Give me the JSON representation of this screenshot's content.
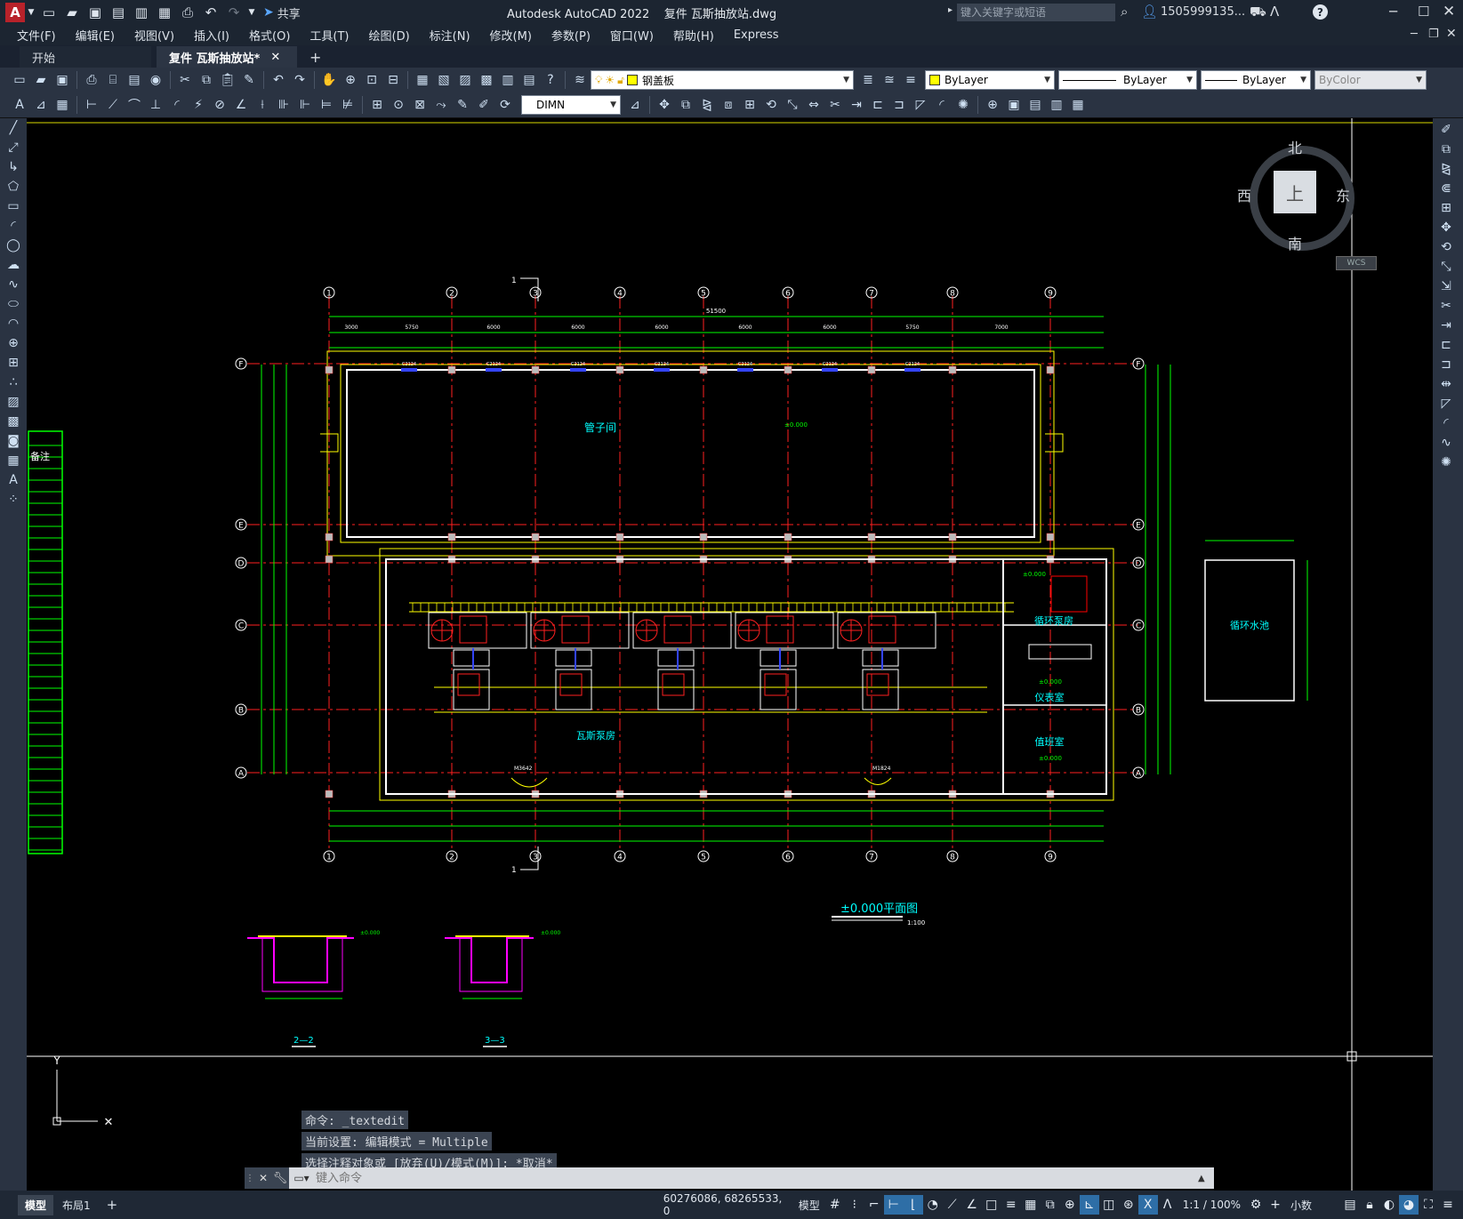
{
  "app": {
    "window_title": "Autodesk AutoCAD 2022    复件 瓦斯抽放站.dwg",
    "share_label": "共享",
    "search_placeholder": "键入关键字或短语",
    "user": "1505999135..."
  },
  "menu": [
    "文件(F)",
    "编辑(E)",
    "视图(V)",
    "插入(I)",
    "格式(O)",
    "工具(T)",
    "绘图(D)",
    "标注(N)",
    "修改(M)",
    "参数(P)",
    "窗口(W)",
    "帮助(H)",
    "Express"
  ],
  "tabs": {
    "start": "开始",
    "doc": "复件 瓦斯抽放站*"
  },
  "toolbar": {
    "layer": "钢盖板",
    "layer_color": "#ffff00",
    "color": "ByLayer",
    "linetype": "ByLayer",
    "lineweight": "ByLayer",
    "plotstyle": "ByColor",
    "dimstyle": "DIMN"
  },
  "viewcube": {
    "north": "北",
    "south": "南",
    "east": "东",
    "west": "西",
    "face": "上",
    "wcs": "WCS"
  },
  "drawing": {
    "grid_cols": [
      "1",
      "2",
      "3",
      "4",
      "5",
      "6",
      "7",
      "8",
      "9"
    ],
    "grid_rows": [
      "F",
      "E",
      "D",
      "C",
      "B",
      "A"
    ],
    "total_dim": "51500",
    "top_dims": [
      "3000",
      "5750",
      "6000",
      "6000",
      "6000",
      "6000",
      "6000",
      "5750",
      "7000"
    ],
    "rooms": {
      "pipe": "管子间",
      "pump": "瓦斯泵房",
      "circ": "循环泵房",
      "inst": "仪表室",
      "duty": "值班室",
      "pool": "循环水池"
    },
    "level": "±0.000",
    "plan_title": "±0.000平面图",
    "plan_scale": "1:100",
    "notes_label": "备注",
    "section_a": "2—2",
    "section_b": "3—3",
    "cut_mark": "1",
    "window_tag": "C2124",
    "door_tag": "M3642",
    "door_tag2": "M1824"
  },
  "command": {
    "history": [
      "命令: _textedit",
      "当前设置: 编辑模式 = Multiple",
      "选择注释对象或 [放弃(U)/模式(M)]: *取消*"
    ],
    "placeholder": "键入命令"
  },
  "status": {
    "model_tab": "模型",
    "layout_tab": "布局1",
    "coords": "60276086, 68265533, 0",
    "space": "模型",
    "scale": "1:1 / 100%",
    "units": "小数"
  }
}
